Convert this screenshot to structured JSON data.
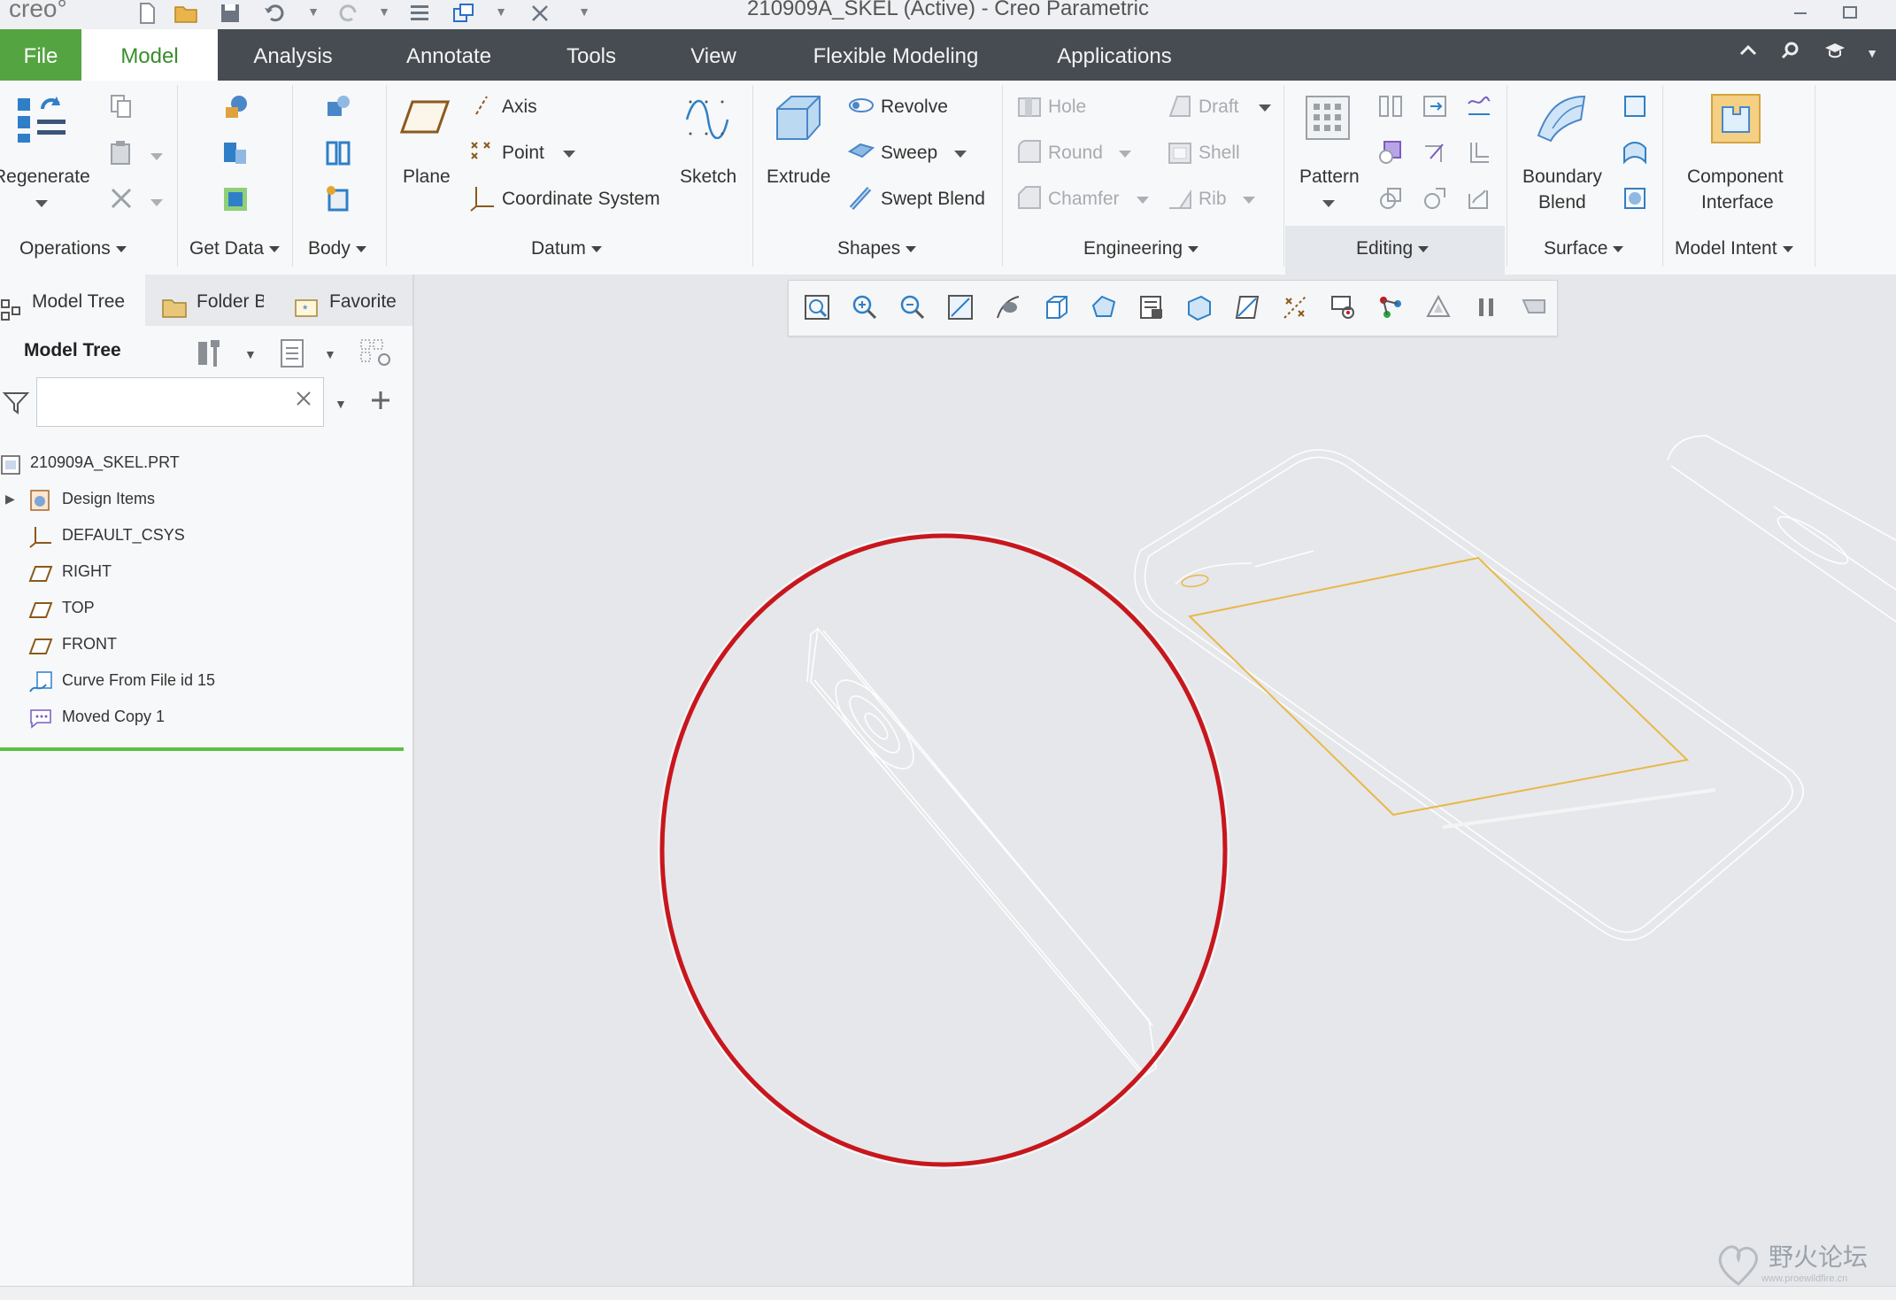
{
  "app": {
    "logo": "creo°",
    "window_title": "210909A_SKEL (Active) - Creo Parametric"
  },
  "menu": {
    "tabs": [
      "File",
      "Model",
      "Analysis",
      "Annotate",
      "Tools",
      "View",
      "Flexible Modeling",
      "Applications"
    ],
    "active_tab": "Model"
  },
  "ribbon": {
    "groups": {
      "operations": "Operations",
      "get_data": "Get Data",
      "body": "Body",
      "datum": "Datum",
      "shapes": "Shapes",
      "engineering": "Engineering",
      "editing": "Editing",
      "surface": "Surface",
      "model_intent": "Model Intent"
    },
    "buttons": {
      "regenerate": "Regenerate",
      "plane": "Plane",
      "axis": "Axis",
      "point": "Point",
      "coordinate_system": "Coordinate System",
      "sketch": "Sketch",
      "extrude": "Extrude",
      "revolve": "Revolve",
      "sweep": "Sweep",
      "swept_blend": "Swept Blend",
      "hole": "Hole",
      "draft": "Draft",
      "round": "Round",
      "shell": "Shell",
      "chamfer": "Chamfer",
      "rib": "Rib",
      "pattern": "Pattern",
      "boundary_blend_1": "Boundary",
      "boundary_blend_2": "Blend",
      "component_interface_1": "Component",
      "component_interface_2": "Interface"
    }
  },
  "navigator": {
    "tabs": [
      "Model Tree",
      "Folder B",
      "Favorites"
    ],
    "header": "Model Tree",
    "search_value": "",
    "items": [
      {
        "label": "210909A_SKEL.PRT",
        "icon": "part-icon"
      },
      {
        "label": "Design Items",
        "icon": "design-items-icon"
      },
      {
        "label": "DEFAULT_CSYS",
        "icon": "csys-icon"
      },
      {
        "label": "RIGHT",
        "icon": "datum-plane-icon"
      },
      {
        "label": "TOP",
        "icon": "datum-plane-icon"
      },
      {
        "label": "FRONT",
        "icon": "datum-plane-icon"
      },
      {
        "label": "Curve From File id 15",
        "icon": "curve-from-file-icon"
      },
      {
        "label": "Moved Copy 1",
        "icon": "moved-copy-icon"
      }
    ]
  },
  "watermark": {
    "text": "野火论坛",
    "url": "www.proewildfire.cn"
  },
  "colors": {
    "menubar": "#474c52",
    "file_tab": "#55a442",
    "active_tab_text": "#3a8c2e",
    "highlight_circle": "#c8161d",
    "sketch_curve": "#e8b84a"
  }
}
